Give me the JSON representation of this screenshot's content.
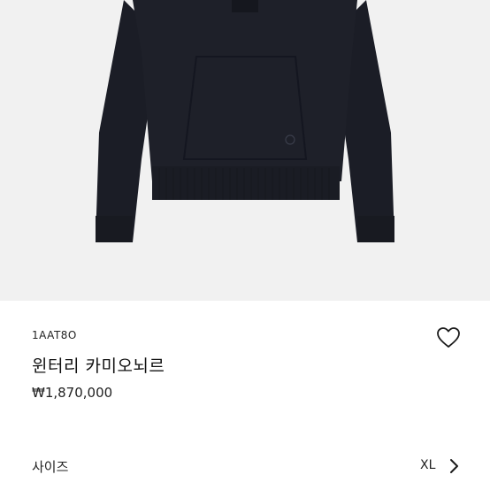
{
  "product": {
    "image_icon": "hoodie-product-image",
    "sku": "1AAT8O",
    "name": "윈터리 카미오뇌르",
    "price": "₩1,870,000",
    "wishlist_icon": "heart-outline-icon"
  },
  "size_selector": {
    "label": "사이즈",
    "value": "XL",
    "icon": "chevron-right-icon"
  },
  "colors": {
    "garment": "#1b1d26",
    "background": "#f1f1f1",
    "text": "#222222"
  }
}
